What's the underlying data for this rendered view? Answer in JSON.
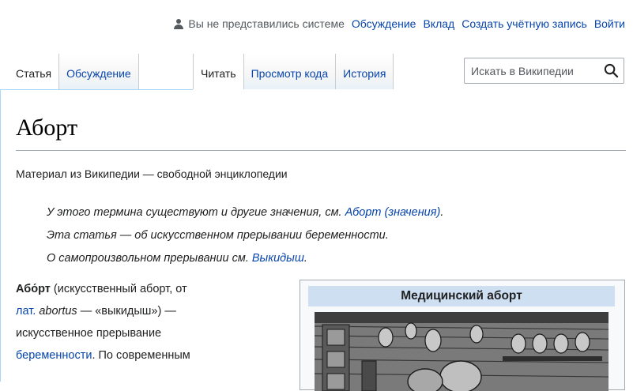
{
  "personal": {
    "anon_text": "Вы не представились системе",
    "links": [
      "Обсуждение",
      "Вклад",
      "Создать учётную запись",
      "Войти"
    ]
  },
  "tabs": {
    "left": [
      {
        "label": "Статья",
        "selected": true
      },
      {
        "label": "Обсуждение",
        "selected": false
      }
    ],
    "right": [
      {
        "label": "Читать",
        "selected": true
      },
      {
        "label": "Просмотр кода",
        "selected": false
      },
      {
        "label": "История",
        "selected": false
      }
    ]
  },
  "search": {
    "placeholder": "Искать в Википедии"
  },
  "article": {
    "title": "Аборт",
    "tagline": "Материал из Википедии — свободной энциклопедии",
    "hatnote1_prefix": "У этого термина существуют и другие значения, см. ",
    "hatnote1_link": "Аборт (значения)",
    "hatnote1_suffix": ".",
    "hatnote2": "Эта статья — об искусственном прерывании беременности.",
    "hatnote3_prefix": "О самопроизвольном прерывании см. ",
    "hatnote3_link": "Выкидыш",
    "hatnote3_suffix": ".",
    "lead": {
      "bold": "Або́рт",
      "t1": " (искусственный аборт, от",
      "link_lat": "лат.",
      "t2_space": " ",
      "latin": "abortus",
      "t3": " — «выкидыш») —",
      "t4": "искусственное прерывание",
      "link_preg": "беременности",
      "t5": ". По современным"
    }
  },
  "infobox": {
    "caption": "Медицинский аборт"
  },
  "colors": {
    "link": "#0645ad",
    "tab_border": "#a7d7f9",
    "infobox_caption_bg": "#cedff2"
  }
}
